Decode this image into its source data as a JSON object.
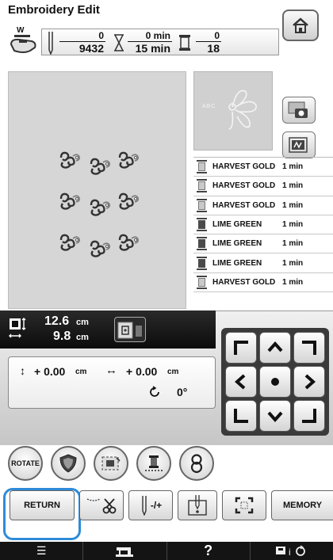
{
  "header": {
    "title": "Embroidery Edit"
  },
  "presser_label": "W",
  "counters": {
    "stitch_current": "0",
    "stitch_total": "9432",
    "time_current": "0 min",
    "time_total": "15 min",
    "color_current": "0",
    "color_total": "18"
  },
  "thumbnail_text": "ABC",
  "thread_colors": [
    {
      "name": "HARVEST GOLD",
      "time": "1 min",
      "tone": "gold"
    },
    {
      "name": "HARVEST GOLD",
      "time": "1 min",
      "tone": "gold"
    },
    {
      "name": "HARVEST GOLD",
      "time": "1 min",
      "tone": "gold"
    },
    {
      "name": "LIME GREEN",
      "time": "1 min",
      "tone": "lime"
    },
    {
      "name": "LIME GREEN",
      "time": "1 min",
      "tone": "lime"
    },
    {
      "name": "LIME GREEN",
      "time": "1 min",
      "tone": "lime"
    },
    {
      "name": "HARVEST GOLD",
      "time": "1 min",
      "tone": "gold"
    }
  ],
  "size": {
    "height": "12.6",
    "width": "9.8",
    "unit": "cm"
  },
  "offset": {
    "vertical": "+ 0.00",
    "horizontal": "+ 0.00",
    "unit": "cm",
    "rotation": "0°"
  },
  "buttons": {
    "rotate": "ROTATE",
    "return": "RETURN",
    "memory": "MEMORY",
    "needle_plus": "-/+"
  },
  "status_bar": {
    "help": "?"
  }
}
